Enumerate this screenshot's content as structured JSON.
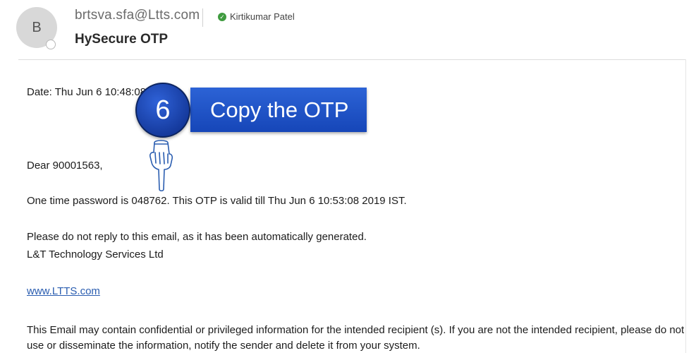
{
  "header": {
    "avatar_initial": "B",
    "sender_email": "brtsva.sfa@Ltts.com",
    "recipient_name": "Kirtikumar Patel",
    "subject": "HySecure OTP"
  },
  "email": {
    "date_line": "Date: Thu Jun  6 10:48:08 2019",
    "greeting": "Dear  90001563,",
    "otp_line": "One time password is 048762. This OTP is valid till Thu Jun  6 10:53:08 2019 IST.",
    "no_reply_line": "Please do not reply to this email, as it has been automatically generated.",
    "company_line": "L&T Technology Services Ltd",
    "website_link": "www.LTTS.com",
    "disclaimer": "This Email may contain confidential or privileged information for the intended recipient (s). If you are not the intended recipient, please do not use or disseminate the information, notify the sender and delete it from your system."
  },
  "callout": {
    "step_number": "6",
    "instruction": "Copy the OTP"
  },
  "icons": {
    "verified": "check-circle-icon",
    "pointer": "pointing-hand-icon"
  },
  "colors": {
    "callout_blue": "#1f55c8",
    "link_blue": "#2a5db0",
    "verified_green": "#3f9b3f"
  }
}
